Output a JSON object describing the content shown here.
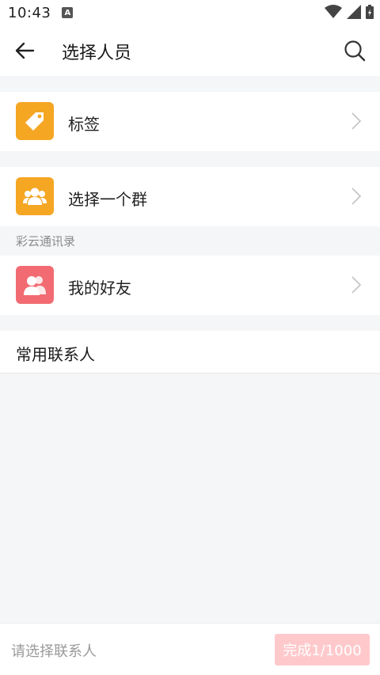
{
  "status_bar": {
    "time": "10:43",
    "notification_icon": "A",
    "icons": [
      "wifi-icon",
      "cellular-signal-icon",
      "battery-charging-icon"
    ]
  },
  "header": {
    "back_icon": "arrow-left-icon",
    "title": "选择人员",
    "search_icon": "search-icon"
  },
  "rows": [
    {
      "label": "标签",
      "icon": "tag-icon",
      "icon_color": "#f5a623"
    },
    {
      "label": "选择一个群",
      "icon": "group-icon",
      "icon_color": "#f5a623"
    },
    {
      "label": "我的好友",
      "icon": "friends-icon",
      "icon_color": "#f26b72"
    }
  ],
  "section_label": "彩云通讯录",
  "frequent_contacts_label": "常用联系人",
  "bottom_bar": {
    "placeholder": "请选择联系人",
    "done_label": "完成1/1000",
    "done_color": "#ffc9cc"
  }
}
